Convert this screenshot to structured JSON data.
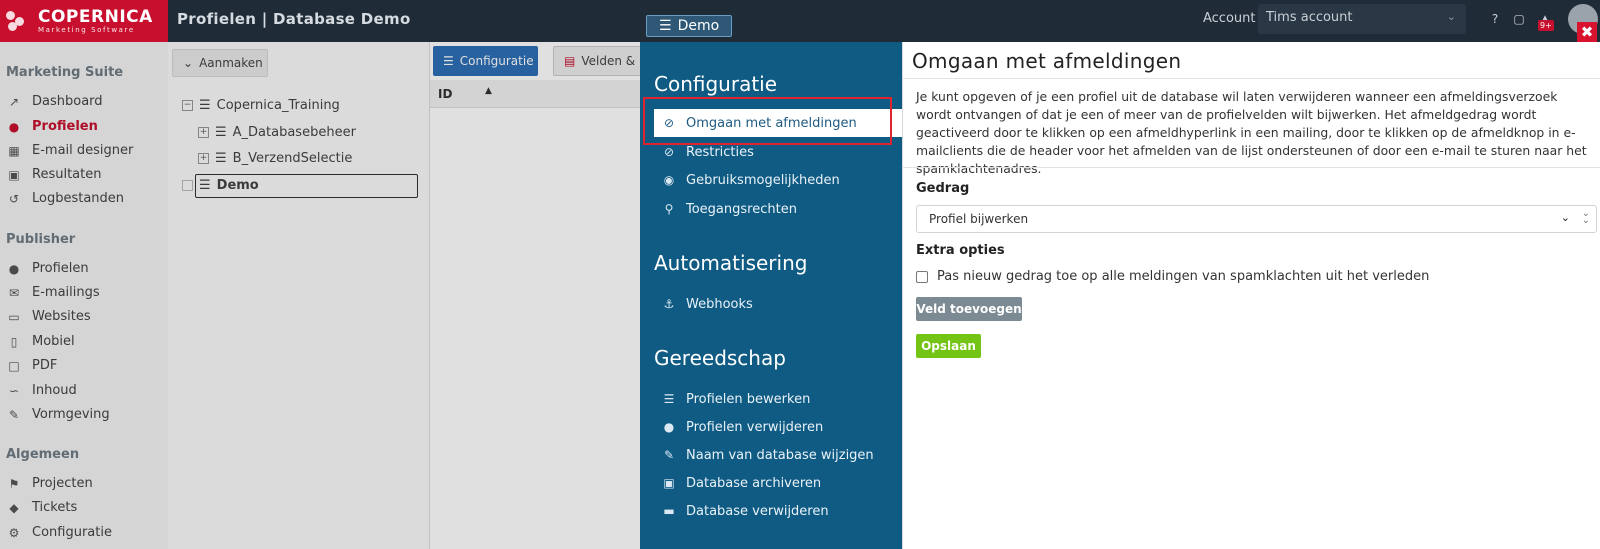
{
  "topbar": {
    "logo_main": "COPERNICA",
    "logo_sub": "Marketing Software",
    "page_title": "Profielen | Database Demo",
    "db_badge": "Demo",
    "account_label": "Account",
    "account_value": "Tims account",
    "notif_count": "9+"
  },
  "sidebar": {
    "sections": [
      {
        "title": "Marketing Suite",
        "items": [
          {
            "label": "Dashboard",
            "icon": "chart-line-icon"
          },
          {
            "label": "Profielen",
            "icon": "users-icon",
            "active": true
          },
          {
            "label": "E-mail designer",
            "icon": "grid-icon"
          },
          {
            "label": "Resultaten",
            "icon": "inbox-icon"
          },
          {
            "label": "Logbestanden",
            "icon": "history-icon"
          }
        ]
      },
      {
        "title": "Publisher",
        "items": [
          {
            "label": "Profielen",
            "icon": "users-icon"
          },
          {
            "label": "E-mailings",
            "icon": "envelope-icon"
          },
          {
            "label": "Websites",
            "icon": "monitor-icon"
          },
          {
            "label": "Mobiel",
            "icon": "mobile-icon"
          },
          {
            "label": "PDF",
            "icon": "file-icon"
          },
          {
            "label": "Inhoud",
            "icon": "rss-icon"
          },
          {
            "label": "Vormgeving",
            "icon": "brush-icon"
          }
        ]
      },
      {
        "title": "Algemeen",
        "items": [
          {
            "label": "Projecten",
            "icon": "flag-icon"
          },
          {
            "label": "Tickets",
            "icon": "ticket-icon"
          },
          {
            "label": "Configuratie",
            "icon": "cogs-icon"
          }
        ]
      }
    ]
  },
  "middle": {
    "create_button": "Aanmaken",
    "tree": [
      {
        "label": "Copernica_Training"
      },
      {
        "label": "A_Databasebeheer"
      },
      {
        "label": "B_VerzendSelectie"
      },
      {
        "label": "Demo"
      }
    ]
  },
  "content": {
    "config_button": "Configuratie",
    "velden_button": "Velden & in",
    "id_column": "ID"
  },
  "config_panel": {
    "section_config": "Configuratie",
    "items_config": [
      {
        "label": "Omgaan met afmeldingen",
        "icon": "unlink-icon",
        "active": true
      },
      {
        "label": "Restricties",
        "icon": "ban-icon"
      },
      {
        "label": "Gebruiksmogelijkheden",
        "icon": "dot-circle-icon"
      },
      {
        "label": "Toegangsrechten",
        "icon": "key-icon"
      }
    ],
    "section_auto": "Automatisering",
    "items_auto": [
      {
        "label": "Webhooks",
        "icon": "anchor-icon"
      }
    ],
    "section_tools": "Gereedschap",
    "items_tools": [
      {
        "label": "Profielen bewerken",
        "icon": "sliders-icon"
      },
      {
        "label": "Profielen verwijderen",
        "icon": "user-times-icon"
      },
      {
        "label": "Naam van database wijzigen",
        "icon": "edit-icon"
      },
      {
        "label": "Database archiveren",
        "icon": "archive-icon"
      },
      {
        "label": "Database verwijderen",
        "icon": "trash-icon"
      }
    ]
  },
  "detail": {
    "title": "Omgaan met afmeldingen",
    "description": "Je kunt opgeven of je een profiel uit de database wil laten verwijderen wanneer een afmeldingsverzoek wordt ontvangen of dat je een of meer van de profielvelden wilt bijwerken. Het afmeldgedrag wordt geactiveerd door te klikken op een afmeldhyperlink in een mailing, door te klikken op de afmeldknop in e-mailclients die de header voor het afmelden van de lijst ondersteunen of door een e-mail te sturen naar het spamklachtenadres.",
    "behavior_label": "Gedrag",
    "behavior_value": "Profiel bijwerken",
    "extra_label": "Extra opties",
    "checkbox_label": "Pas nieuw gedrag toe op alle meldingen van spamklachten uit het verleden",
    "add_field_button": "Veld toevoegen",
    "save_button": "Opslaan"
  },
  "colors": {
    "brand": "#c8102e",
    "topbar": "#1f2b36",
    "config_panel": "#0f5b84",
    "save": "#73c414",
    "highlight": "#e0242f"
  }
}
